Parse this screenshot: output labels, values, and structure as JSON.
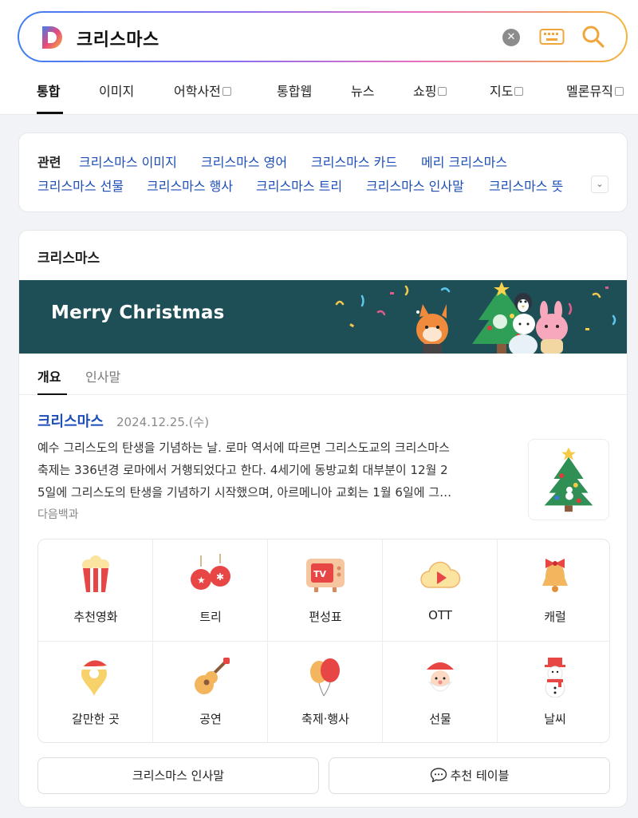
{
  "search": {
    "query": "크리스마스"
  },
  "tabs": [
    {
      "label": "통합",
      "external": false
    },
    {
      "label": "이미지",
      "external": false
    },
    {
      "label": "어학사전",
      "external": true
    },
    {
      "label": "통합웹",
      "external": false
    },
    {
      "label": "뉴스",
      "external": false
    },
    {
      "label": "쇼핑",
      "external": true
    },
    {
      "label": "지도",
      "external": true
    },
    {
      "label": "멜론뮤직",
      "external": true
    }
  ],
  "related": {
    "title": "관련",
    "links": [
      "크리스마스 이미지",
      "크리스마스 영어",
      "크리스마스 카드",
      "메리 크리스마스",
      "크리스마스 선물",
      "크리스마스 행사",
      "크리스마스 트리",
      "크리스마스 인사말",
      "크리스마스 뜻"
    ]
  },
  "main": {
    "title": "크리스마스",
    "banner_text": "Merry Christmas",
    "subtabs": [
      "개요",
      "인사말"
    ],
    "entry": {
      "title": "크리스마스",
      "date": "2024.12.25.(수)",
      "desc_lines": [
        "예수 그리스도의 탄생을 기념하는 날. 로마 역서에 따르면 그리스도교의 크리스마스",
        "축제는 336년경 로마에서 거행되었다고 한다. 4세기에 동방교회 대부분이 12월 2",
        "5일에 그리스도의 탄생을 기념하기 시작했으며, 아르메니아 교회는 1월 6일에 그…"
      ],
      "source": "다음백과"
    },
    "grid": [
      {
        "label": "추천영화",
        "icon": "popcorn-icon"
      },
      {
        "label": "트리",
        "icon": "ornaments-icon"
      },
      {
        "label": "편성표",
        "icon": "tv-icon"
      },
      {
        "label": "OTT",
        "icon": "play-cloud-icon"
      },
      {
        "label": "캐럴",
        "icon": "bell-icon"
      },
      {
        "label": "갈만한 곳",
        "icon": "map-pin-icon"
      },
      {
        "label": "공연",
        "icon": "guitar-icon"
      },
      {
        "label": "축제·행사",
        "icon": "balloons-icon"
      },
      {
        "label": "선물",
        "icon": "santa-icon"
      },
      {
        "label": "날씨",
        "icon": "snowman-icon"
      }
    ],
    "buttons": [
      "크리스마스 인사말",
      "추천 테이블"
    ]
  }
}
